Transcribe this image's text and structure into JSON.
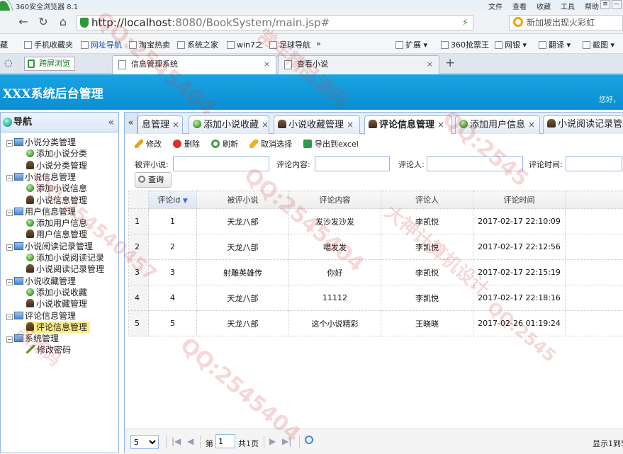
{
  "browser": {
    "title": "360安全浏览器 8.1",
    "menus": [
      "文件",
      "查看",
      "收藏",
      "工具",
      "帮助"
    ],
    "url_host": "http://localhost",
    "url_path": ":8080/BookSystem/main.jsp#",
    "search_placeholder": "新加坡出现火彩虹",
    "favorites": [
      "藏",
      "手机收藏夹",
      "网址导航",
      "淘宝热卖",
      "系统之家",
      "win7之",
      "足球导航",
      "»",
      "扩展",
      "360抢票王",
      "网银",
      "翻译",
      "截图"
    ],
    "left_tab": "跨屏浏览",
    "tabs": [
      {
        "label": "信息管理系统",
        "active": true
      },
      {
        "label": "查看小说",
        "active": false
      }
    ],
    "new_tab": "+"
  },
  "app": {
    "title": "XXX系统后台管理",
    "greeting": "您好，"
  },
  "sidebar": {
    "header": "导航",
    "collapse": "«",
    "tree": [
      {
        "label": "小说分类管理",
        "level": 0,
        "kind": "folder"
      },
      {
        "label": "添加小说分类",
        "level": 1,
        "kind": "add"
      },
      {
        "label": "小说分类管理",
        "level": 1,
        "kind": "user"
      },
      {
        "label": "小说信息管理",
        "level": 0,
        "kind": "folder"
      },
      {
        "label": "添加小说信息",
        "level": 1,
        "kind": "add"
      },
      {
        "label": "小说信息管理",
        "level": 1,
        "kind": "user"
      },
      {
        "label": "用户信息管理",
        "level": 0,
        "kind": "folder"
      },
      {
        "label": "添加用户信息",
        "level": 1,
        "kind": "add"
      },
      {
        "label": "用户信息管理",
        "level": 1,
        "kind": "user"
      },
      {
        "label": "小说阅读记录管理",
        "level": 0,
        "kind": "folder"
      },
      {
        "label": "添加小说阅读记录",
        "level": 1,
        "kind": "add"
      },
      {
        "label": "小说阅读记录管理",
        "level": 1,
        "kind": "user"
      },
      {
        "label": "小说收藏管理",
        "level": 0,
        "kind": "folder"
      },
      {
        "label": "添加小说收藏",
        "level": 1,
        "kind": "add"
      },
      {
        "label": "小说收藏管理",
        "level": 1,
        "kind": "user"
      },
      {
        "label": "评论信息管理",
        "level": 0,
        "kind": "folder"
      },
      {
        "label": "评论信息管理",
        "level": 1,
        "kind": "user",
        "selected": true
      },
      {
        "label": "系统管理",
        "level": 0,
        "kind": "folder"
      },
      {
        "label": "修改密码",
        "level": 1,
        "kind": "pen"
      }
    ]
  },
  "tabs": {
    "scroll_left": "«",
    "items": [
      {
        "label": "息管理",
        "icon": "none",
        "active": false
      },
      {
        "label": "添加小说收藏",
        "icon": "add",
        "active": false
      },
      {
        "label": "小说收藏管理",
        "icon": "user",
        "active": false
      },
      {
        "label": "评论信息管理",
        "icon": "user",
        "active": true
      },
      {
        "label": "添加用户信息",
        "icon": "add",
        "active": false
      },
      {
        "label": "小说阅读记录管理",
        "icon": "user",
        "active": false
      }
    ]
  },
  "toolbar": {
    "edit": "修改",
    "delete": "删除",
    "refresh": "刷新",
    "cancel": "取消选择",
    "export": "导出到excel"
  },
  "filters": {
    "novel_label": "被评小说:",
    "content_label": "评论内容:",
    "user_label": "评论人:",
    "time_label": "评论时间:",
    "search_button": "查询"
  },
  "grid": {
    "columns": [
      "",
      "评论id",
      "被评小说",
      "评论内容",
      "评论人",
      "评论时间"
    ],
    "sort_arrow": "▼",
    "rows": [
      [
        "1",
        "1",
        "天龙八部",
        "发沙发沙发",
        "李凯悦",
        "2017-02-17 22:10:09"
      ],
      [
        "2",
        "2",
        "天龙八部",
        "噶发发",
        "李凯悦",
        "2017-02-17 22:12:56"
      ],
      [
        "3",
        "3",
        "射雕英雄传",
        "你好",
        "李凯悦",
        "2017-02-17 22:15:19"
      ],
      [
        "4",
        "4",
        "天龙八部",
        "11112",
        "李凯悦",
        "2017-02-17 22:18:16"
      ],
      [
        "5",
        "5",
        "天龙八部",
        "这个小说精彩",
        "王晓晓",
        "2017-02-26 01:19:24"
      ]
    ]
  },
  "pager": {
    "page_size": "5",
    "page_prefix": "第",
    "page_value": "1",
    "page_total": "共1页",
    "display": "显示1到5,"
  },
  "watermark": {
    "qq": "QQ:2545404",
    "qq2": "QQ:254540457",
    "brand": "大神计算机设计",
    "brand2": "常年精品源码",
    "brand3": "品源码",
    "qq3": "QQ:2545"
  }
}
